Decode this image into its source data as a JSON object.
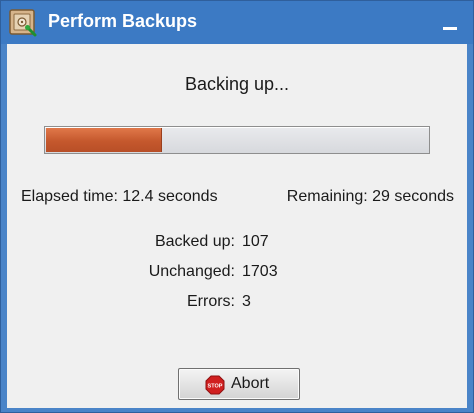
{
  "window": {
    "title": "Perform Backups"
  },
  "status": {
    "heading": "Backing up...",
    "progress_fraction": 0.3,
    "elapsed_text": "Elapsed time: 12.4 seconds",
    "remaining_text": "Remaining: 29 seconds"
  },
  "stats": [
    {
      "label": "Backed up:",
      "value": "107"
    },
    {
      "label": "Unchanged:",
      "value": "1703"
    },
    {
      "label": "Errors:",
      "value": "3"
    }
  ],
  "actions": {
    "abort_label": "Abort",
    "stop_icon_text": "STOP"
  },
  "colors": {
    "titlebar": "#3c7ac4",
    "progress_fill": "#c5582d",
    "stop_red": "#d01f1f"
  },
  "icons": {
    "app": "backup-safe-icon",
    "minimize": "minimize-icon",
    "stop": "stop-sign-icon"
  }
}
